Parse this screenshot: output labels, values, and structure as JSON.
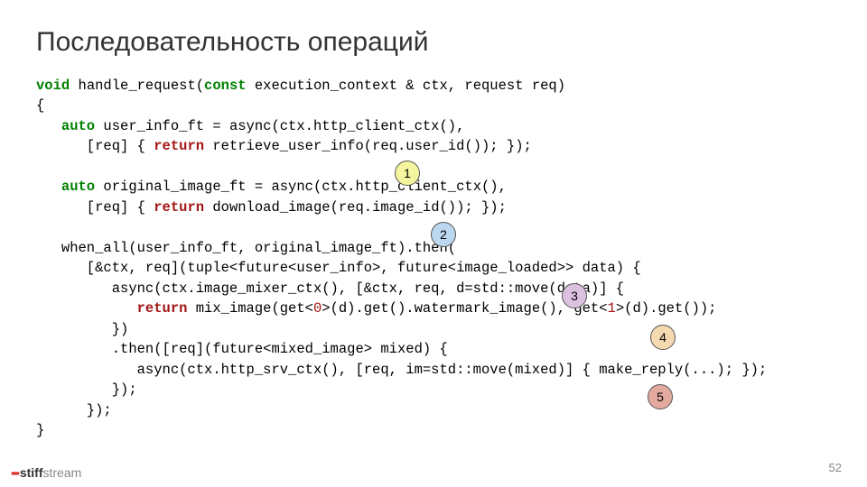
{
  "title": "Последовательность операций",
  "code": {
    "kw_void": "void",
    "fn_sig": " handle_request(",
    "kw_const": "const",
    "fn_sig2": " execution_context & ctx, request req)",
    "lbrace": "{",
    "l1a": "   ",
    "kw_auto1": "auto",
    "l1b": " user_info_ft = async(ctx.http_client_ctx(),",
    "l2a": "      [req] { ",
    "kw_ret1": "return",
    "l2b": " retrieve_user_info(req.user_id()); });",
    "blank1": "",
    "l3a": "   ",
    "kw_auto2": "auto",
    "l3b": " original_image_ft = async(ctx.http_client_ctx(),",
    "l4a": "      [req] { ",
    "kw_ret2": "return",
    "l4b": " download_image(req.image_id()); });",
    "blank2": "",
    "l5": "   when_all(user_info_ft, original_image_ft).then(",
    "l6": "      [&ctx, req](tuple<future<user_info>, future<image_loaded>> data) {",
    "l7": "         async(ctx.image_mixer_ctx(), [&ctx, req, d=std::move(data)] {",
    "l8a": "            ",
    "kw_ret3": "return",
    "l8b": " mix_image(get<",
    "num0": "0",
    "l8c": ">(d).get().watermark_image(), get<",
    "num1": "1",
    "l8d": ">(d).get());",
    "l9": "         })",
    "l10": "         .then([req](future<mixed_image> mixed) {",
    "l11": "            async(ctx.http_srv_ctx(), [req, im=std::move(mixed)] { make_reply(...); });",
    "l12": "         });",
    "l13": "      });",
    "rbrace": "}"
  },
  "markers": {
    "m1": "1",
    "m2": "2",
    "m3": "3",
    "m4": "4",
    "m5": "5"
  },
  "page_number": "52",
  "logo": {
    "stiff": "stiff",
    "stream": "stream"
  }
}
